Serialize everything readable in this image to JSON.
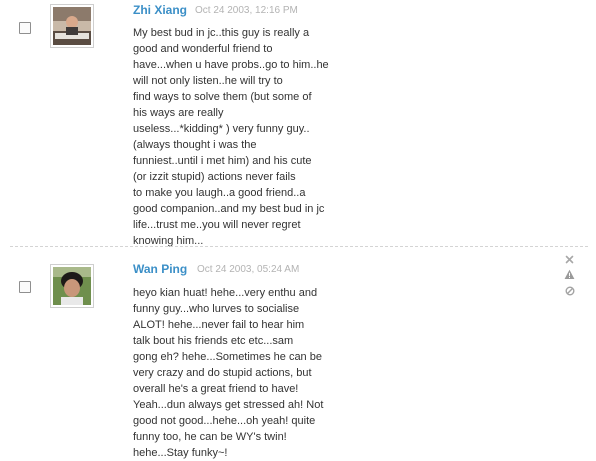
{
  "comments": [
    {
      "author": "Zhi Xiang",
      "date": "Oct 24 2003, 12:16 PM",
      "lines": [
        "My best bud in jc..this guy is really a",
        "good and wonderful friend to",
        "have...when u have probs..go to him..he",
        "will not only listen..he will try to",
        "find ways to solve them (but some of",
        "his ways are really",
        "useless...*kidding* ) very funny guy..",
        "(always thought i was the",
        "funniest..until i met him) and his cute",
        "(or izzit stupid) actions never fails",
        "to make you laugh..a good friend..a",
        "good companion..and my best bud in jc",
        "life...trust me..you will never regret",
        "knowing him..."
      ]
    },
    {
      "author": "Wan Ping",
      "date": "Oct 24 2003, 05:24 AM",
      "lines": [
        "heyo kian huat! hehe...very enthu and",
        "funny guy...who lurves to socialise",
        "ALOT! hehe...never fail to hear him",
        "talk bout his friends etc etc...sam",
        "gong eh? hehe...Sometimes he can be",
        "very crazy and do stupid actions, but",
        "overall he's a great friend to have!",
        "Yeah...dun always get stressed ah! Not",
        "good not good...hehe...oh yeah! quite",
        "funny too, he can be WY's twin!",
        "hehe...Stay funky~!"
      ],
      "actions": [
        "delete-icon",
        "report-icon",
        "block-icon"
      ]
    }
  ],
  "colors": {
    "author": "#3b8fc7",
    "date": "#b3b3b3",
    "text": "#333333",
    "divider": "#d4d4d4"
  }
}
